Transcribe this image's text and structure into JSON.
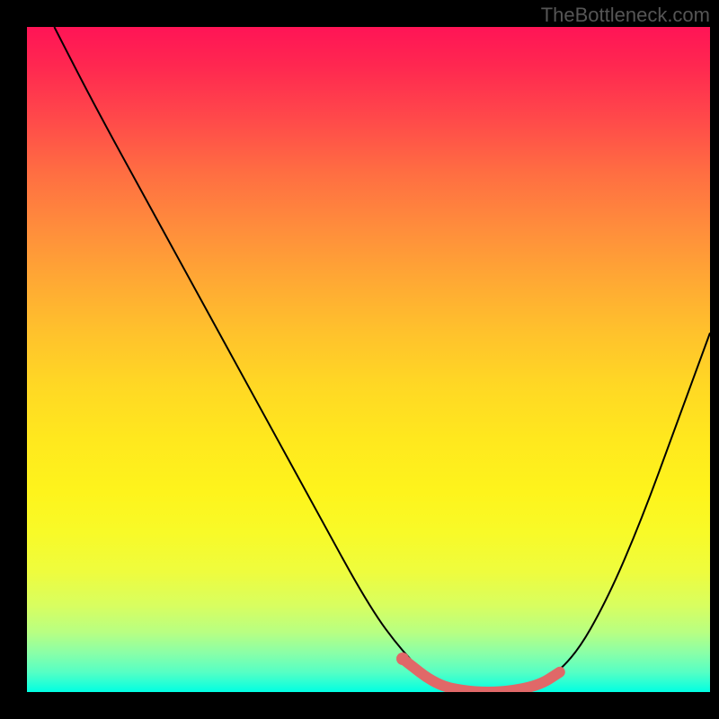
{
  "watermark": "TheBottleneck.com",
  "chart_data": {
    "type": "line",
    "title": "",
    "xlabel": "",
    "ylabel": "",
    "xlim": [
      0,
      100
    ],
    "ylim": [
      0,
      100
    ],
    "series": [
      {
        "name": "bottleneck-curve",
        "color": "#000000",
        "x": [
          4,
          10,
          18,
          26,
          34,
          42,
          50,
          55,
          60,
          65,
          70,
          75,
          80,
          85,
          90,
          95,
          100
        ],
        "y": [
          100,
          88,
          73,
          58,
          43,
          28,
          13,
          6,
          1,
          0,
          0,
          1,
          5,
          14,
          26,
          40,
          54
        ]
      },
      {
        "name": "highlight-band",
        "color": "#e06868",
        "x": [
          55,
          60,
          65,
          70,
          75,
          78
        ],
        "y": [
          5,
          1,
          0,
          0,
          1,
          3
        ]
      }
    ],
    "gradient_stops": [
      {
        "pos": 0,
        "color": "#ff1456"
      },
      {
        "pos": 50,
        "color": "#ffd824"
      },
      {
        "pos": 100,
        "color": "#00ffe2"
      }
    ]
  }
}
